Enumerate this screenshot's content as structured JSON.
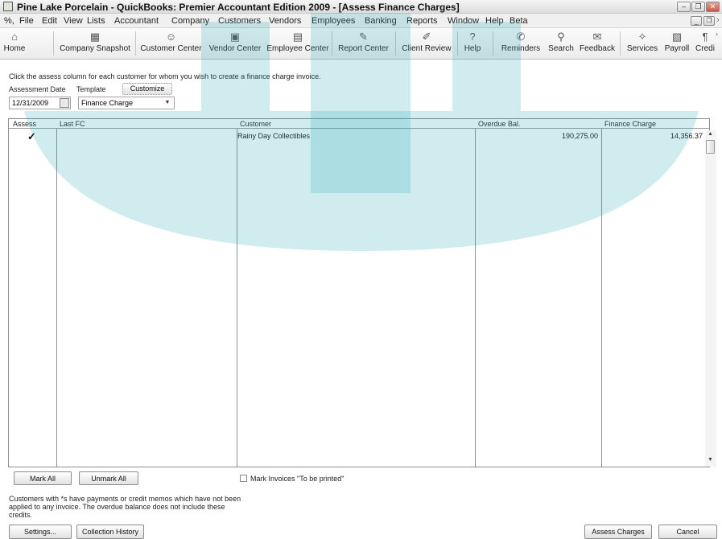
{
  "window": {
    "title": "Pine Lake Porcelain - QuickBooks: Premier Accountant Edition 2009 - [Assess Finance Charges]",
    "controls": {
      "minimize": "–",
      "restore": "❐",
      "close": "✕"
    },
    "inner_controls": {
      "minimize": "_",
      "restore": "❐",
      "close": "›"
    }
  },
  "menu": {
    "system_icon": "%,",
    "items": [
      "File",
      "Edit",
      "View",
      "Lists",
      "Accountant",
      "Company",
      "Customers",
      "Vendors",
      "Employees",
      "Banking",
      "Reports",
      "Window",
      "Help",
      "Beta"
    ]
  },
  "toolbar": {
    "home": {
      "label": "Home",
      "icon": "home-icon",
      "glyph": "⌂"
    },
    "company_snapshot": {
      "label": "Company Snapshot",
      "icon": "snapshot-icon",
      "glyph": "▦"
    },
    "customer_center": {
      "label": "Customer Center",
      "icon": "customer-center-icon",
      "glyph": "☺"
    },
    "vendor_center": {
      "label": "Vendor Center",
      "icon": "vendor-center-icon",
      "glyph": "▣"
    },
    "employee_center": {
      "label": "Employee Center",
      "icon": "employee-center-icon",
      "glyph": "▤"
    },
    "report_center": {
      "label": "Report Center",
      "icon": "report-center-icon",
      "glyph": "✎"
    },
    "client_review": {
      "label": "Client Review",
      "icon": "client-review-icon",
      "glyph": "✐"
    },
    "help": {
      "label": "Help",
      "icon": "help-icon",
      "glyph": "?"
    },
    "reminders": {
      "label": "Reminders",
      "icon": "reminders-icon",
      "glyph": "✆"
    },
    "search": {
      "label": "Search",
      "icon": "search-icon",
      "glyph": "⚲"
    },
    "feedback": {
      "label": "Feedback",
      "icon": "feedback-icon",
      "glyph": "✉"
    },
    "services": {
      "label": "Services",
      "icon": "services-icon",
      "glyph": "✧"
    },
    "payroll": {
      "label": "Payroll",
      "icon": "payroll-icon",
      "glyph": "▧"
    },
    "credit": {
      "label": "Credi",
      "icon": "credit-icon",
      "glyph": "¶"
    },
    "overflow_glyph": "›"
  },
  "form": {
    "instruction": "Click the assess column for each customer for whom you wish to create a finance charge invoice.",
    "assessment_date_label": "Assessment Date",
    "template_label": "Template",
    "customize_label": "Customize",
    "assessment_date": "12/31/2009",
    "template_value": "Finance Charge",
    "calendar_icon": "calendar-icon",
    "dropdown_icon": "chevron-down-icon"
  },
  "table": {
    "columns": [
      "Assess",
      "Last FC",
      "Customer",
      "Overdue Bal.",
      "Finance Charge"
    ],
    "rows": [
      {
        "assess": "✓",
        "last_fc": "",
        "customer": "Rainy Day Collectibles",
        "overdue_bal": "190,275.00",
        "finance_charge": "14,356.37"
      }
    ]
  },
  "actions": {
    "mark_all": "Mark All",
    "unmark_all": "Unmark All",
    "mark_invoices_print": "Mark Invoices \"To be printed\"",
    "mark_invoices_checked": false,
    "footnote_lines": [
      "Customers with *s have payments or credit memos which have not been",
      "applied to any invoice.  The overdue balance does not include these",
      "credits."
    ],
    "settings": "Settings...",
    "collection_history": "Collection History",
    "assess_charges": "Assess Charges",
    "cancel": "Cancel"
  },
  "colors": {
    "watermark": "#2aa8b8",
    "button_border": "#8c8c8c",
    "grid_border": "#8e8e8e"
  }
}
